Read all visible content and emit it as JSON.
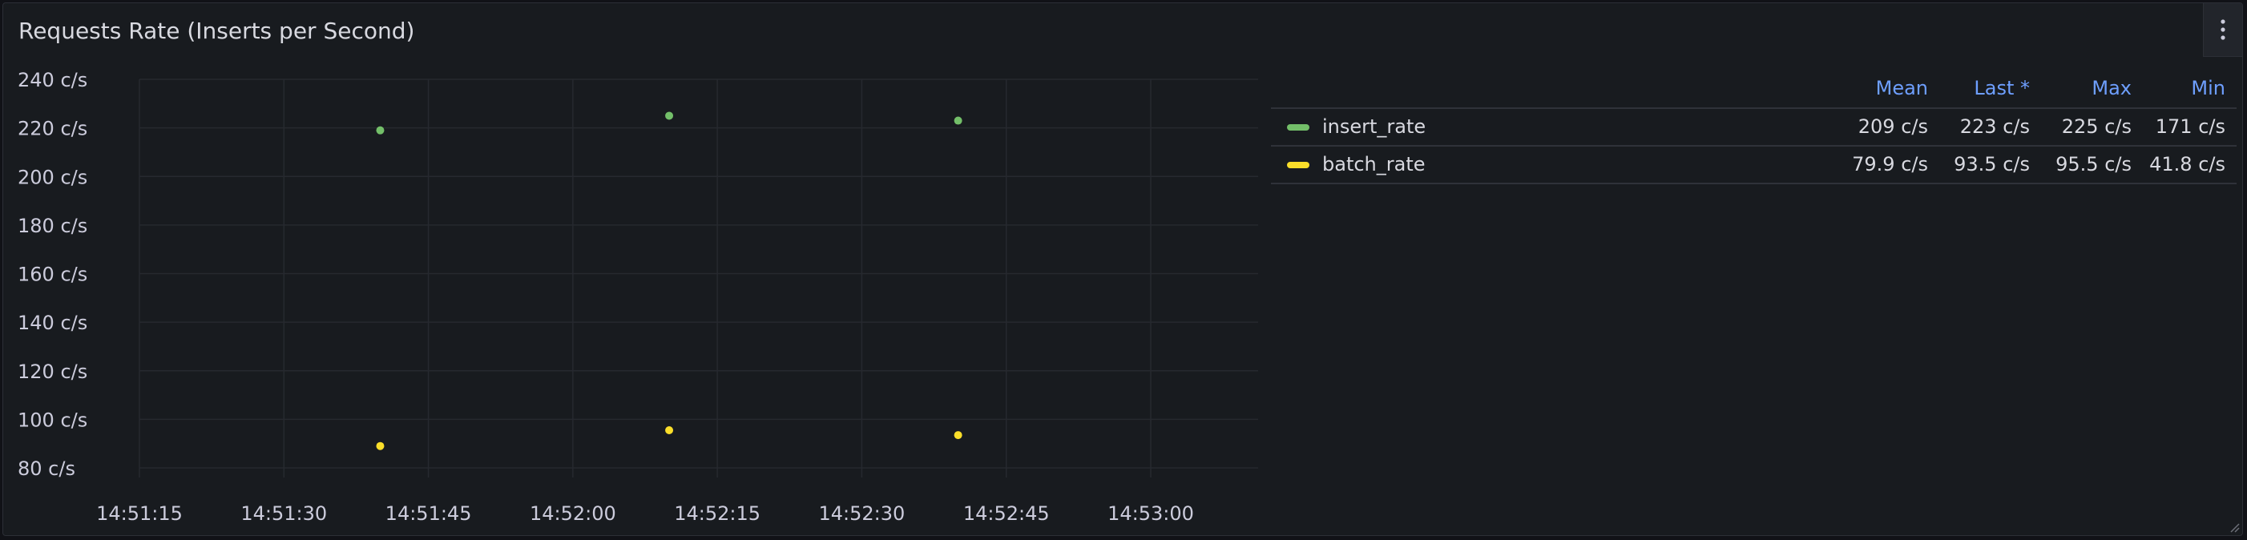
{
  "panel": {
    "title": "Requests Rate (Inserts per Second)",
    "menu_icon": "kebab-vertical-icon"
  },
  "chart_data": {
    "type": "scatter",
    "title": "Requests Rate (Inserts per Second)",
    "xlabel": "",
    "ylabel": "",
    "unit": "c/s",
    "x_ticks": [
      "14:51:15",
      "14:51:30",
      "14:51:45",
      "14:52:00",
      "14:52:15",
      "14:52:30",
      "14:52:45",
      "14:53:00"
    ],
    "y_ticks": [
      "240 c/s",
      "220 c/s",
      "200 c/s",
      "180 c/s",
      "160 c/s",
      "140 c/s",
      "120 c/s",
      "100 c/s",
      "80 c/s"
    ],
    "ylim": [
      80,
      240
    ],
    "xlim": [
      "14:51:15",
      "14:53:00"
    ],
    "grid": true,
    "legend_placement": "right",
    "series": [
      {
        "name": "insert_rate",
        "color": "#73bf69",
        "x": [
          "14:51:40",
          "14:52:10",
          "14:52:40"
        ],
        "values": [
          219,
          225,
          223
        ]
      },
      {
        "name": "batch_rate",
        "color": "#fade2a",
        "x": [
          "14:51:40",
          "14:52:10",
          "14:52:40"
        ],
        "values": [
          89,
          95.5,
          93.5
        ]
      }
    ]
  },
  "legend": {
    "columns": [
      "Mean",
      "Last *",
      "Max",
      "Min"
    ],
    "rows": [
      {
        "name": "insert_rate",
        "color": "#73bf69",
        "mean": "209 c/s",
        "last": "223 c/s",
        "max": "225 c/s",
        "min": "171 c/s"
      },
      {
        "name": "batch_rate",
        "color": "#fade2a",
        "mean": "79.9 c/s",
        "last": "93.5 c/s",
        "max": "95.5 c/s",
        "min": "41.8 c/s"
      }
    ]
  }
}
